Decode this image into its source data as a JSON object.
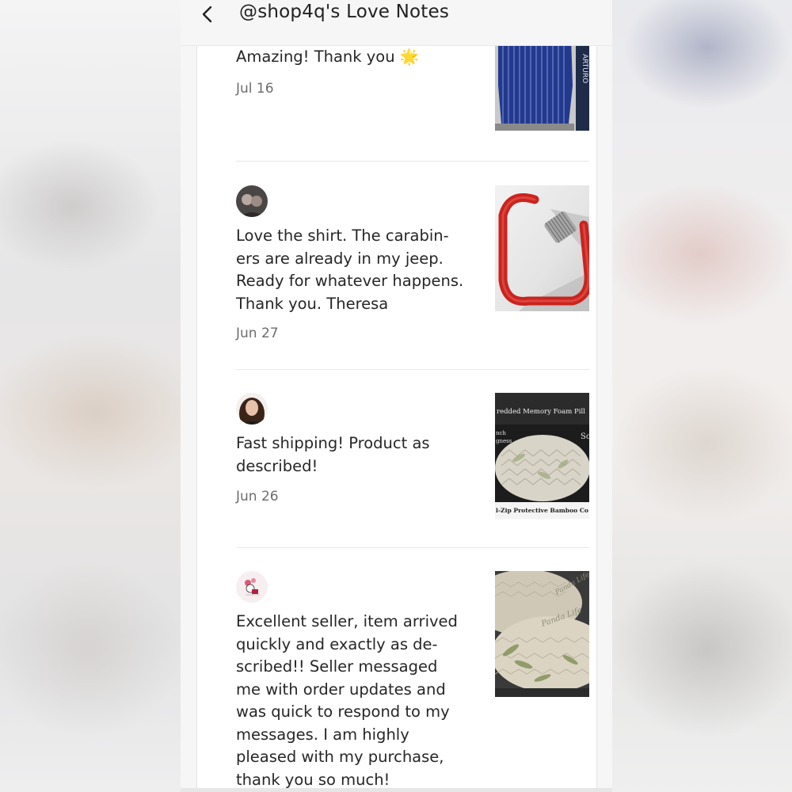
{
  "header": {
    "title": "@shop4q's Love Notes"
  },
  "notes": [
    {
      "text": "Amazing! Thank you ",
      "emoji": "🌟",
      "date": "Jul 16",
      "product_icon": "striped-shirt-image"
    },
    {
      "text": "Love the shirt. The carabin-\ners are already in my jeep.\nReady for whatever happens.\nThank you. Theresa",
      "date": "Jun 27",
      "product_icon": "red-carabiner-image"
    },
    {
      "text": "Fast shipping! Product as\ndescribed!",
      "date": "Jun 26",
      "product_icon": "memory-foam-pillow-image",
      "thumb_text_top": "redded Memory Foam Pill",
      "thumb_text_left1": "nch",
      "thumb_text_left2": "gness",
      "thumb_text_right": "Sc",
      "thumb_text_bottom": "l-Zip Protective Bamboo Co"
    },
    {
      "text": "Excellent seller, item arrived\nquickly and exactly as de-\nscribed!! Seller messaged\nme with order updates and\nwas quick to respond to my\nmessages. I am highly\npleased with my purchase,\nthank you so much!",
      "date": "",
      "product_icon": "bamboo-pillows-image",
      "thumb_text_1": "Panda Life",
      "thumb_text_2": "Panda Life"
    }
  ],
  "colors": {
    "accent_red": "#c9241f",
    "text": "#262626",
    "muted": "#6d6d6d"
  }
}
